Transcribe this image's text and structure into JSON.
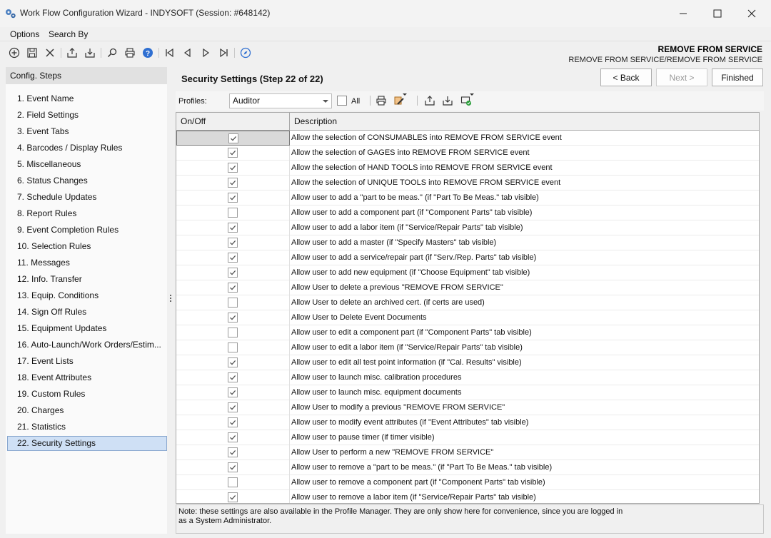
{
  "window": {
    "title": "Work Flow Configuration Wizard - INDYSOFT (Session: #648142)",
    "icon": "gears-icon"
  },
  "menu": {
    "options": "Options",
    "search_by": "Search By"
  },
  "event": {
    "title": "REMOVE FROM SERVICE",
    "subtitle": "REMOVE FROM SERVICE/REMOVE FROM SERVICE"
  },
  "steps": {
    "header": "Config. Steps",
    "items": [
      "1. Event Name",
      "2. Field Settings",
      "3. Event Tabs",
      "4. Barcodes / Display Rules",
      "5. Miscellaneous",
      "6. Status Changes",
      "7. Schedule Updates",
      "8. Report Rules",
      "9. Event Completion Rules",
      "10. Selection Rules",
      "11. Messages",
      "12. Info. Transfer",
      "13. Equip. Conditions",
      "14. Sign Off Rules",
      "15. Equipment Updates",
      "16. Auto-Launch/Work Orders/Estim...",
      "17. Event Lists",
      "18. Event Attributes",
      "19. Custom Rules",
      "20. Charges",
      "21. Statistics",
      "22. Security Settings"
    ],
    "selected_index": 21
  },
  "main": {
    "section_title": "Security Settings (Step 22 of 22)",
    "back_label": "< Back",
    "next_label": "Next >",
    "finished_label": "Finished"
  },
  "filter": {
    "profiles_label": "Profiles:",
    "profile_value": "Auditor",
    "all_label": "All",
    "all_checked": false
  },
  "grid": {
    "col_onoff": "On/Off",
    "col_description": "Description",
    "rows": [
      {
        "checked": true,
        "description": "Allow the selection of CONSUMABLES into REMOVE FROM SERVICE event"
      },
      {
        "checked": true,
        "description": "Allow the selection of GAGES into REMOVE FROM SERVICE event"
      },
      {
        "checked": true,
        "description": "Allow the selection of HAND TOOLS into REMOVE FROM SERVICE event"
      },
      {
        "checked": true,
        "description": "Allow the selection of UNIQUE TOOLS into REMOVE FROM SERVICE event"
      },
      {
        "checked": true,
        "description": "Allow user to add a \"part to be meas.\" (if \"Part To Be Meas.\" tab visible)"
      },
      {
        "checked": false,
        "description": "Allow user to add a component part (if \"Component Parts\" tab visible)"
      },
      {
        "checked": true,
        "description": "Allow user to add a labor item (if \"Service/Repair Parts\" tab visible)"
      },
      {
        "checked": true,
        "description": "Allow user to add a master (if \"Specify Masters\" tab visible)"
      },
      {
        "checked": true,
        "description": "Allow user to add a service/repair part (if \"Serv./Rep. Parts\" tab visible)"
      },
      {
        "checked": true,
        "description": "Allow user to add new equipment (if \"Choose Equipment\" tab visible)"
      },
      {
        "checked": true,
        "description": "Allow User to delete a previous \"REMOVE FROM SERVICE\""
      },
      {
        "checked": false,
        "description": "Allow User to delete an archived cert. (if certs are used)"
      },
      {
        "checked": true,
        "description": "Allow User to Delete Event Documents"
      },
      {
        "checked": false,
        "description": "Allow user to edit a component part (if \"Component Parts\" tab visible)"
      },
      {
        "checked": false,
        "description": "Allow user to edit a labor item (if \"Service/Repair Parts\" tab visible)"
      },
      {
        "checked": true,
        "description": "Allow user to edit all test point information (if \"Cal. Results\" visible)"
      },
      {
        "checked": true,
        "description": "Allow user to launch misc. calibration procedures"
      },
      {
        "checked": true,
        "description": "Allow user to launch misc. equipment documents"
      },
      {
        "checked": true,
        "description": "Allow User to modify a previous \"REMOVE FROM SERVICE\""
      },
      {
        "checked": true,
        "description": "Allow user to modify event attributes (if \"Event Attributes\" tab visible)"
      },
      {
        "checked": true,
        "description": "Allow user to pause timer (if timer visible)"
      },
      {
        "checked": true,
        "description": "Allow User to perform a new \"REMOVE FROM SERVICE\""
      },
      {
        "checked": true,
        "description": "Allow user to remove a \"part to be meas.\" (if \"Part To Be Meas.\" tab visible)"
      },
      {
        "checked": false,
        "description": "Allow user to remove a component part (if \"Component Parts\" tab visible)"
      },
      {
        "checked": true,
        "description": "Allow user to remove a labor item (if \"Service/Repair Parts\" tab visible)"
      }
    ]
  },
  "note": {
    "line1": "Note:  these settings are also available in the Profile Manager.  They are only show here for convenience, since you are logged in",
    "line2": "as a System Administrator."
  },
  "colors": {
    "selection": "#cfe0f5",
    "help_icon": "#2f6fd1",
    "export_green": "#2a9d3a"
  }
}
